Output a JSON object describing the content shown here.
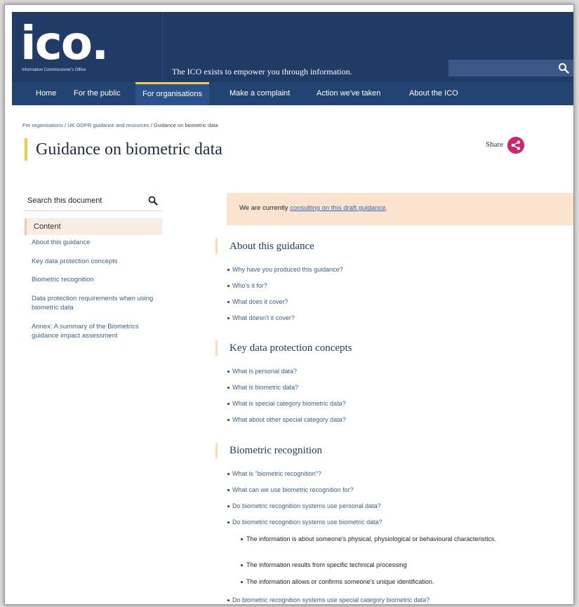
{
  "header": {
    "logo_text": "ico.",
    "logo_subtext": "Information Commissioner's Office",
    "tagline": "The ICO exists to empower you through information.",
    "search_icon": "search-icon"
  },
  "nav": {
    "items": [
      {
        "label": "Home"
      },
      {
        "label": "For the public"
      },
      {
        "label": "For organisations",
        "active": true
      },
      {
        "label": "Make a complaint"
      },
      {
        "label": "Action we've taken"
      },
      {
        "label": "About the ICO"
      }
    ]
  },
  "breadcrumb": {
    "items": [
      "For organisations",
      "UK GDPR guidance and resources",
      "Guidance on biometric data"
    ],
    "separator": "/"
  },
  "page": {
    "title": "Guidance on biometric data",
    "share_label": "Share",
    "share_icon": "share-icon"
  },
  "sidebar": {
    "search_label": "Search this document",
    "content_label": "Content",
    "links": [
      "About this guidance",
      "Key data protection concepts",
      "Biometric recognition",
      "Data protection requirements when using biometric data",
      "Annex: A summary of the Biometrics guidance impact assessment"
    ]
  },
  "notice": {
    "prefix": "We are currently ",
    "link": "consulting on this draft guidance",
    "suffix": "."
  },
  "sections": [
    {
      "heading": "About this guidance",
      "items": [
        "Why have you produced this guidance?",
        "Who's it for?",
        "What does it cover?",
        "What doesn't it cover?"
      ]
    },
    {
      "heading": "Key data protection concepts",
      "items": [
        "What is personal data?",
        "What is biometric data?",
        "What is special category biometric data?",
        "What about other special category data?"
      ]
    },
    {
      "heading": "Biometric recognition",
      "items": [
        "What is \"biometric recognition\"?",
        "What can we use biometric recognition for?",
        "Do biometric recognition systems use personal data?",
        "Do biometric recognition systems use biometric data?",
        "Do biometric recognition systems use special category biometric data?"
      ],
      "sub_items": [
        "The information is about someone's physical, physiological or behavioural characteristics.",
        "The information results from specific technical processing",
        "The information allows or confirms someone's unique identification."
      ]
    }
  ],
  "colors": {
    "header_bg": "#1f3b66",
    "nav_bg": "#234472",
    "accent_yellow": "#f6c945",
    "link": "#3a5f93",
    "notice_bg": "#fbe3d0",
    "share": "#d2216f"
  }
}
